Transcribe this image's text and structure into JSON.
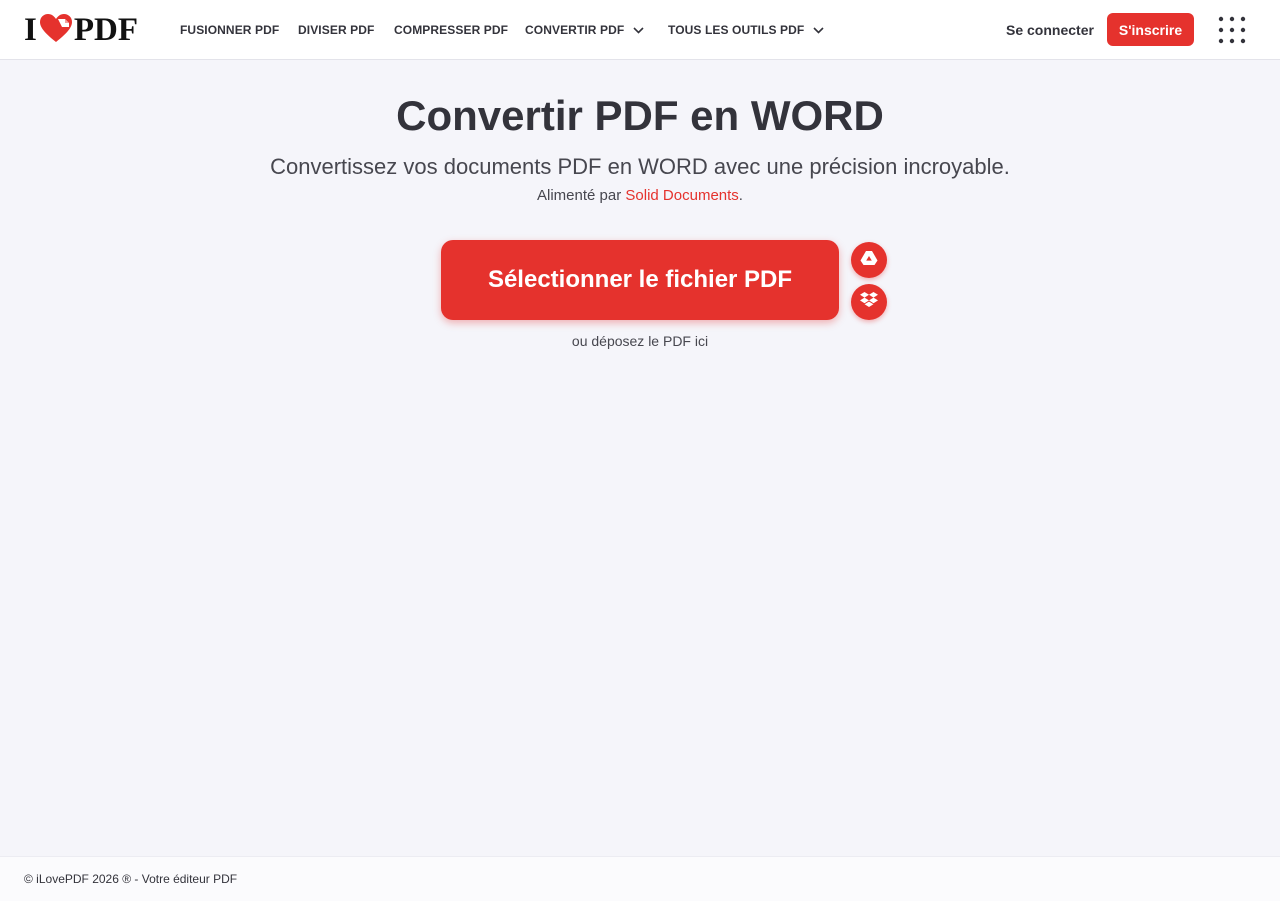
{
  "header": {
    "logo": {
      "left": "I",
      "right": "PDF"
    },
    "nav": [
      {
        "label": "FUSIONNER PDF",
        "dropdown": false
      },
      {
        "label": "DIVISER PDF",
        "dropdown": false
      },
      {
        "label": "COMPRESSER PDF",
        "dropdown": false
      },
      {
        "label": "CONVERTIR PDF",
        "dropdown": true
      },
      {
        "label": "TOUS LES OUTILS PDF",
        "dropdown": true
      }
    ],
    "login_label": "Se connecter",
    "signup_label": "S'inscrire",
    "apps_icon": "grid-apps-icon"
  },
  "main": {
    "title": "Convertir PDF en WORD",
    "subtitle": "Convertissez vos documents PDF en WORD avec une précision incroyable.",
    "powered_prefix": "Alimenté par",
    "powered_link": "Solid Documents",
    "powered_suffix": ".",
    "select_label": "Sélectionner le fichier PDF",
    "cloud_sources": [
      {
        "name": "Google Drive",
        "icon": "google-drive-icon"
      },
      {
        "name": "Dropbox",
        "icon": "dropbox-icon"
      }
    ],
    "drop_hint": "ou déposez le PDF ici"
  },
  "footer": {
    "text": "© iLovePDF 2026 ® - Votre éditeur PDF"
  },
  "colors": {
    "brand": "#e5322d",
    "text": "#33333b",
    "background": "#f5f5fa"
  }
}
